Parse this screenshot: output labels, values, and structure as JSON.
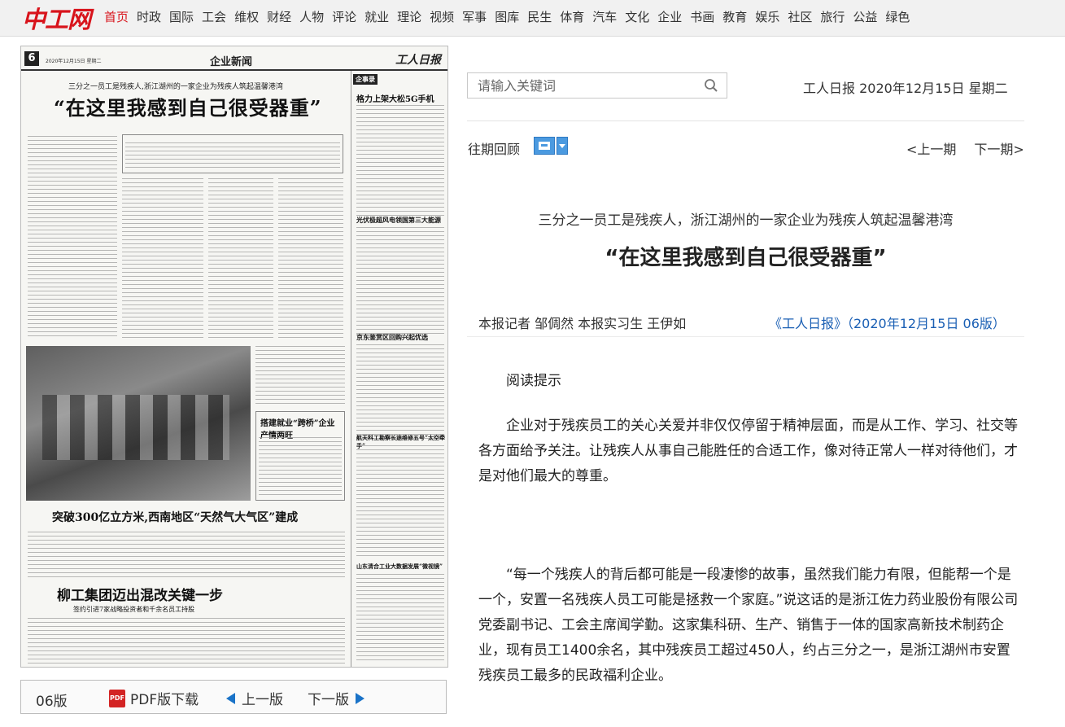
{
  "logo": {
    "text": "中工网"
  },
  "nav": {
    "items": [
      "首页",
      "时政",
      "国际",
      "工会",
      "维权",
      "财经",
      "人物",
      "评论",
      "就业",
      "理论",
      "视频",
      "军事",
      "图库",
      "民生",
      "体育",
      "汽车",
      "文化",
      "企业",
      "书画",
      "教育",
      "娱乐",
      "社区",
      "旅行",
      "公益",
      "绿色"
    ],
    "active_index": 0,
    "active_color": "#d8141c"
  },
  "newspaper": {
    "page_num": "6",
    "date_line": "2020年12月15日 星期二",
    "section": "企业新闻",
    "brand": "工人日报",
    "subheadline": "三分之一员工是残疾人,浙江湖州的一家企业为残疾人筑起温馨港湾",
    "headline": "“在这里我感到自己很受器重”",
    "tag": "企事录",
    "right_titles": [
      "格力上架大松5G手机",
      "光伏极超风电领国第三大能源",
      "京东鉴赏区回购兴起优选",
      "航天科工勘察长途维修五号“太空牵手”",
      "山东清合工业大数据发展“微视镜”"
    ],
    "mid_title": "搭建就业“跨桥”企业产情两旺",
    "big_title": "突破300亿立方米,西南地区“天然气大气区”建成",
    "bottom_title": "柳工集团迈出混改关键一步",
    "bottom_sub": "签约引进7家战略投资者和千余名员工持股"
  },
  "pager": {
    "page_label": "06版",
    "pdf_label": "PDF版下载",
    "prev_label": "上一版",
    "next_label": "下一版"
  },
  "search": {
    "placeholder": "请输入关键词"
  },
  "header_date": "工人日报 2020年12月15日 星期二",
  "history_label": "往期回顾",
  "period_prev": "<上一期",
  "period_next": "下一期>",
  "article": {
    "subtitle": "三分之一员工是残疾人，浙江湖州的一家企业为残疾人筑起温馨港湾",
    "title": "“在这里我感到自己很受器重”",
    "byline": "本报记者 邹倜然 本报实习生 王伊如",
    "source": "《工人日报》（2020年12月15日 06版）",
    "source_color": "#1a5fb4",
    "paragraphs": [
      "阅读提示",
      "企业对于残疾员工的关心关爱并非仅仅停留于精神层面，而是从工作、学习、社交等各方面给予关注。让残疾人从事自己能胜任的合适工作，像对待正常人一样对待他们，才是对他们最大的尊重。",
      "“每一个残疾人的背后都可能是一段凄惨的故事，虽然我们能力有限，但能帮一个是一个，安置一名残疾人员工可能是拯救一个家庭。”说这话的是浙江佐力药业股份有限公司党委副书记、工会主席闻学勤。这家集科研、生产、销售于一体的国家高新技术制药企业，现有员工1400余名，其中残疾员工超过450人，约占三分之一，是浙江湖州市安置残疾员工最多的民政福利企业。"
    ]
  }
}
